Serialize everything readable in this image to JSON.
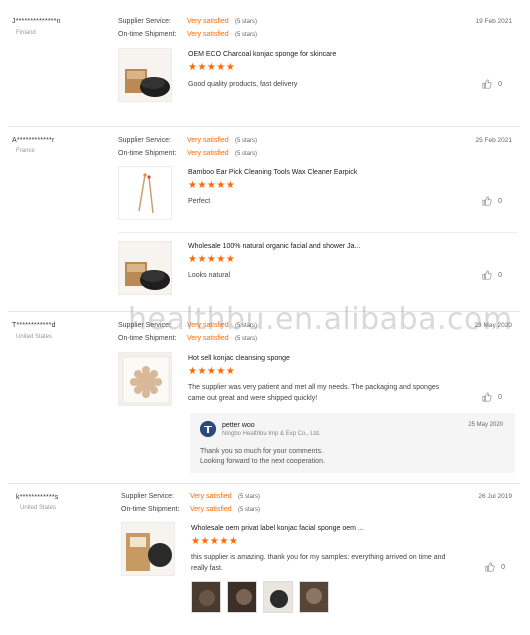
{
  "colors": {
    "accent": "#ff6a00"
  },
  "labels": {
    "supplier_service": "Supplier Service:",
    "on_time_shipment": "On-time Shipment:"
  },
  "watermark": "healthbu.en.alibaba.com",
  "reviews": [
    {
      "buyer": "J**************n",
      "country": "Finland",
      "date": "19 Feb 2021",
      "supplier_service": "Very satisfied",
      "supplier_service_stars": "(5 stars)",
      "shipment": "Very satisfied",
      "shipment_stars": "(5 stars)",
      "products": [
        {
          "title": "OEM ECO Charcoal konjac sponge for skincare",
          "stars": "★★★★★",
          "comment": "Good quality products, fast delivery",
          "likes": "0"
        }
      ]
    },
    {
      "buyer": "A************r",
      "country": "France",
      "date": "25 Feb 2021",
      "supplier_service": "Very satisfied",
      "supplier_service_stars": "(5 stars)",
      "shipment": "Very satisfied",
      "shipment_stars": "(5 stars)",
      "products": [
        {
          "title": "Bamboo Ear Pick Cleaning Tools Wax Cleaner Earpick",
          "stars": "★★★★★",
          "comment": "Perfect",
          "likes": "0"
        },
        {
          "title": "Wholesale 100% natural organic facial and shower Ja...",
          "stars": "★★★★★",
          "comment": "Looks natural",
          "likes": "0"
        }
      ]
    },
    {
      "buyer": "T************d",
      "country": "United States",
      "date": "23 May 2020",
      "supplier_service": "Very satisfied",
      "supplier_service_stars": "(5 stars)",
      "shipment": "Very satisfied",
      "shipment_stars": "(5 stars)",
      "products": [
        {
          "title": "Hot sell konjac cleansing sponge",
          "stars": "★★★★★",
          "comment": "The supplier was very patient and met all my needs. The packaging and sponges came out great and were shipped quickly!",
          "likes": "0"
        }
      ],
      "reply": {
        "name": "petter woo",
        "company": "Ningbo Healthbu Imp & Exp Co., Ltd.",
        "date": "25 May 2020",
        "line1": "Thank you so much for your comments.",
        "line2": "Looking forward to the next cooperation."
      }
    },
    {
      "buyer": "k************s",
      "country": "United States",
      "date": "26 Jul 2019",
      "supplier_service": "Very satisfied",
      "supplier_service_stars": "(5 stars)",
      "shipment": "Very satisfied",
      "shipment_stars": "(5 stars)",
      "products": [
        {
          "title": "Wholesale oem privat label konjac facial sponge oem ...",
          "stars": "★★★★★",
          "comment": "this supplier is amazing. thank you for my samples: everything arrived on time and really fast.",
          "likes": "0"
        }
      ]
    }
  ]
}
